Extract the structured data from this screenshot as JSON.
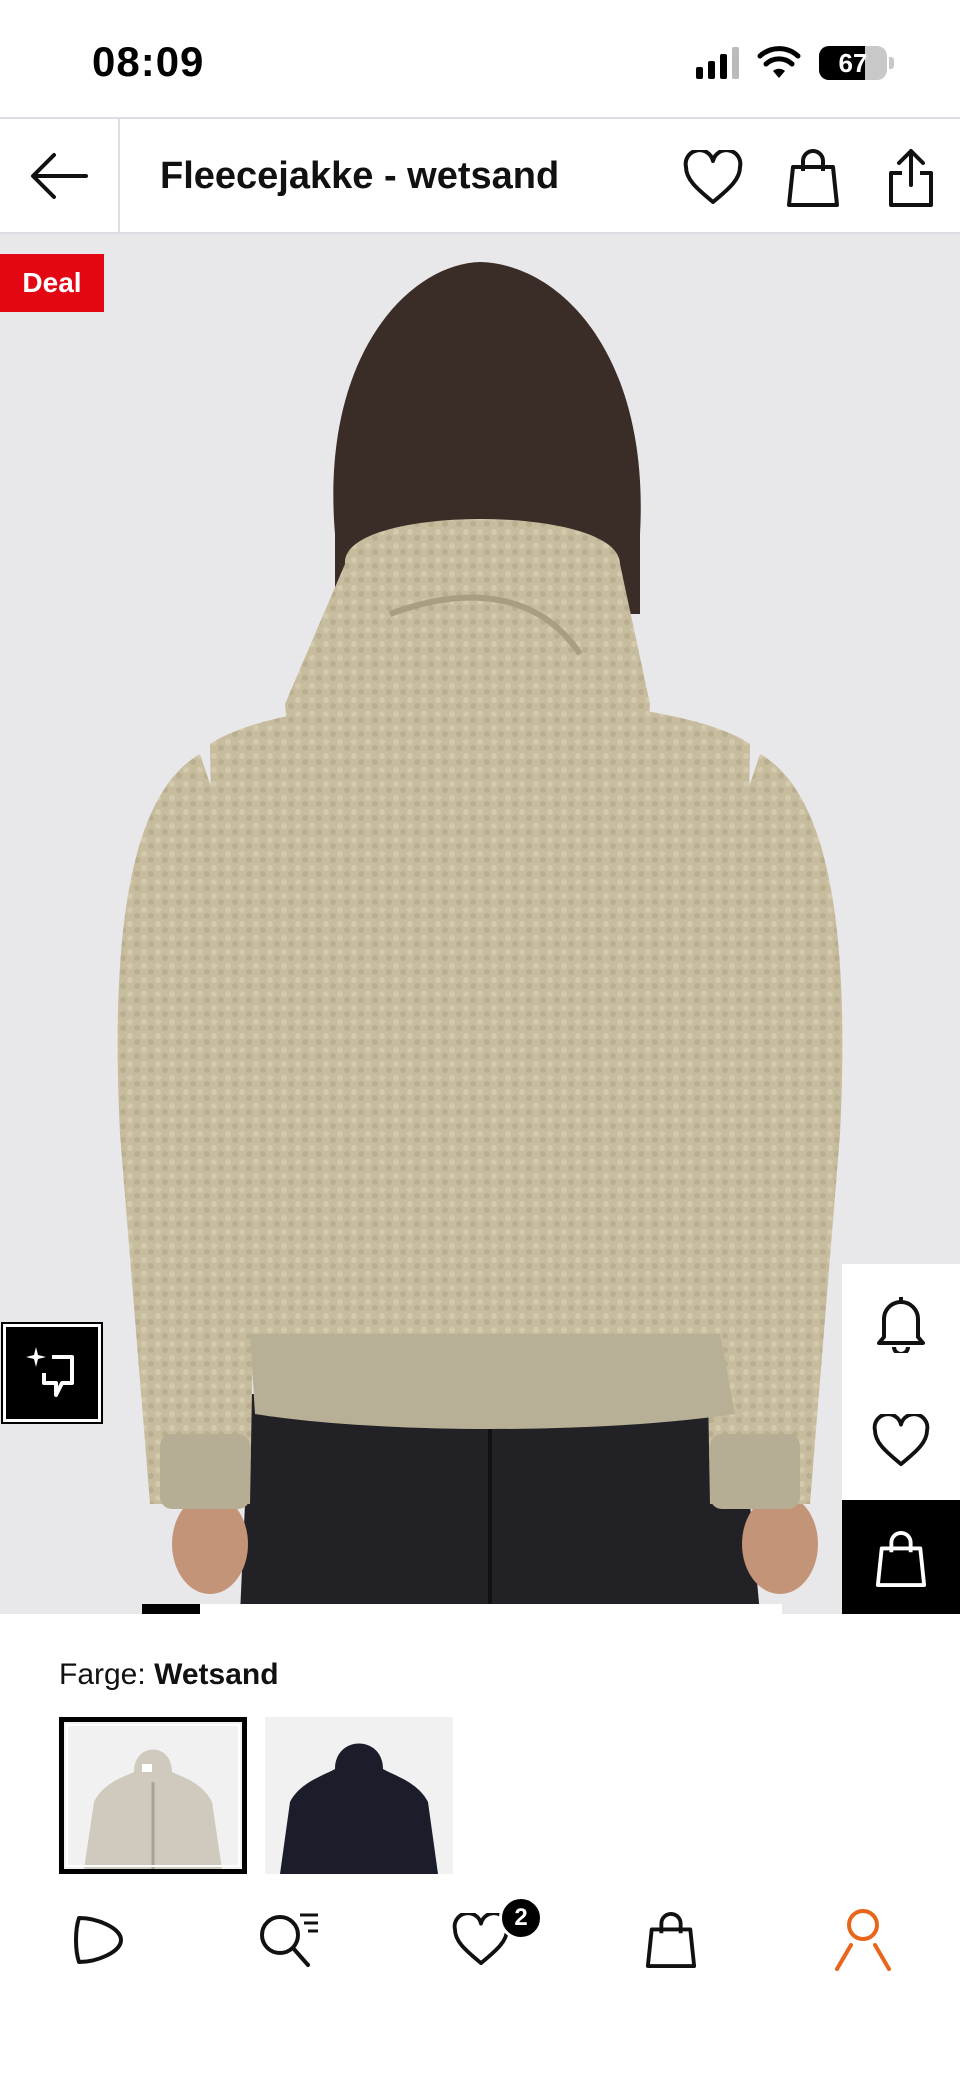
{
  "status": {
    "time": "08:09",
    "battery": "67",
    "battery_level": 0.67
  },
  "header": {
    "title": "Fleecejakke - wetsand"
  },
  "gallery": {
    "badge": "Deal",
    "current_image": 1,
    "progress": 0.09
  },
  "product": {
    "color_label": "Farge:",
    "color_value": "Wetsand"
  },
  "swatches": [
    {
      "name": "Wetsand",
      "selected": true,
      "color": "#cfcabd"
    },
    {
      "name": "Black",
      "selected": false,
      "color": "#1b1e2a"
    }
  ],
  "nav": {
    "wishlist_count": "2",
    "active": "account"
  },
  "colors": {
    "deal_red": "#e30613",
    "accent_orange": "#e8651b",
    "fleece": "#c8bd9f",
    "background": "#e8e8ea"
  },
  "icons": [
    "back-arrow-icon",
    "heart-icon",
    "bag-icon",
    "share-icon",
    "ai-search-icon",
    "bell-icon",
    "play-icon",
    "search-icon",
    "account-icon"
  ]
}
